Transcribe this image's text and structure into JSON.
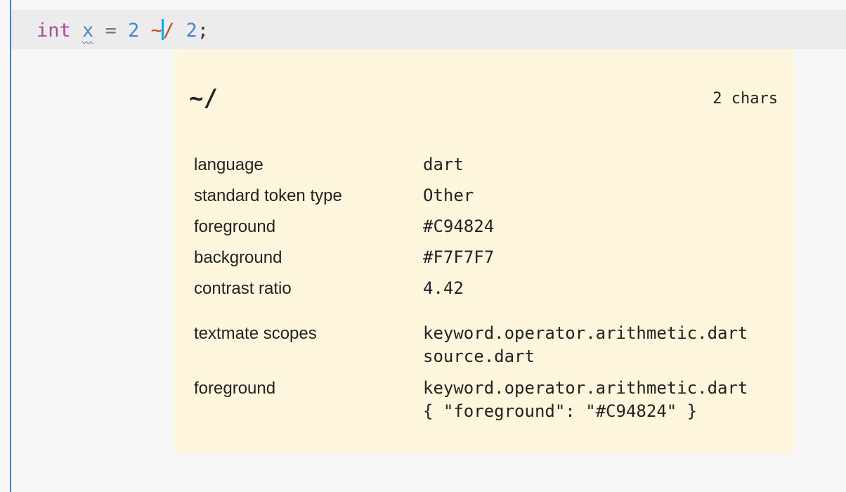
{
  "editor": {
    "code": {
      "keyword": "int",
      "identifier": "x",
      "equals": "=",
      "left_operand": "2",
      "operator_part1": "~",
      "operator_part2": "/",
      "right_operand": "2",
      "semicolon": ";"
    },
    "colors": {
      "keyword": "#b0489d",
      "identifier": "#4b83cd",
      "operator": "#C94824",
      "cursor": "#1aa6e8"
    }
  },
  "hover": {
    "token": "~/",
    "length": "2 chars",
    "rows": [
      {
        "label": "language",
        "value": "dart"
      },
      {
        "label": "standard token type",
        "value": "Other"
      },
      {
        "label": "foreground",
        "value": "#C94824"
      },
      {
        "label": "background",
        "value": "#F7F7F7"
      },
      {
        "label": "contrast ratio",
        "value": "4.42"
      }
    ],
    "textmate": {
      "label": "textmate scopes",
      "line1": "keyword.operator.arithmetic.dart",
      "line2": "source.dart"
    },
    "theme_rule": {
      "label": "foreground",
      "line1": "keyword.operator.arithmetic.dart",
      "line2": "{ \"foreground\": \"#C94824\" }"
    }
  }
}
